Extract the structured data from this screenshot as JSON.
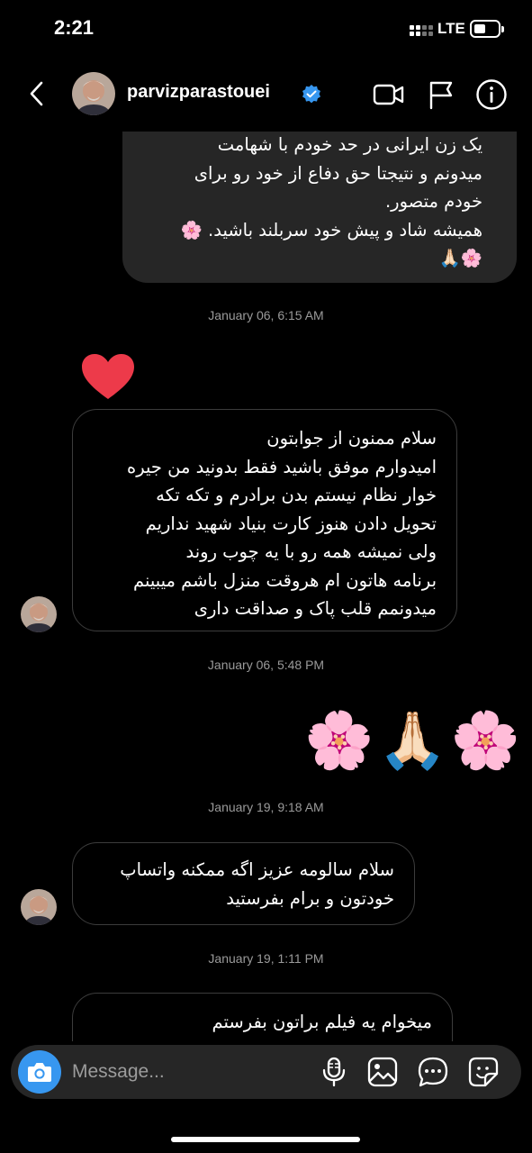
{
  "status": {
    "time": "2:21",
    "network": "LTE"
  },
  "header": {
    "username": "parvizparastouei",
    "verified": true,
    "icons": [
      "back-icon",
      "video-icon",
      "flag-icon",
      "info-icon"
    ]
  },
  "messages": [
    {
      "direction": "outgoing",
      "text": "یک زن ایرانی در حد خودم با شهامت\nمیدونم و نتیجتا حق دفاع از خود رو برای\nخودم متصور.\nهمیشه شاد و پیش خود سربلند باشید. 🌸\n🌸🙏🏻"
    },
    {
      "timestamp": "January 06, 6:15 AM"
    },
    {
      "direction": "outgoing",
      "reaction": "heart"
    },
    {
      "direction": "incoming",
      "text": "سلام ممنون از جوابتون\nامیدوارم موفق باشید فقط بدونید من جیره\nخوار نظام نیستم بدن برادرم و تکه تکه\nتحویل دادن هنوز کارت بنیاد شهید نداریم\nولی نمیشه همه رو با یه چوب روند\nبرنامه هاتون ام هروقت منزل باشم میبینم\nمیدونمم قلب پاک و صداقت داری"
    },
    {
      "timestamp": "January 06, 5:48 PM"
    },
    {
      "direction": "outgoing",
      "emoji": [
        "🌸",
        "🙏🏻",
        "🌸"
      ]
    },
    {
      "timestamp": "January 19, 9:18 AM"
    },
    {
      "direction": "incoming",
      "text": "سلام سالومه عزیز اگه ممکنه  واتساپ\nخودتون و برام بفرستید"
    },
    {
      "timestamp": "January 19, 1:11 PM"
    },
    {
      "direction": "incoming",
      "text": "میخوام یه فیلم براتون بفرستم"
    }
  ],
  "composer": {
    "placeholder": "Message...",
    "icons": [
      "camera-icon",
      "microphone-icon",
      "gallery-icon",
      "chat-icon",
      "sticker-icon"
    ]
  },
  "colors": {
    "accent": "#3797f0",
    "verified": "#3797f0",
    "heart": "#ed3a4a",
    "bubble_out": "#262626",
    "bubble_in_border": "#3c3c3c"
  }
}
